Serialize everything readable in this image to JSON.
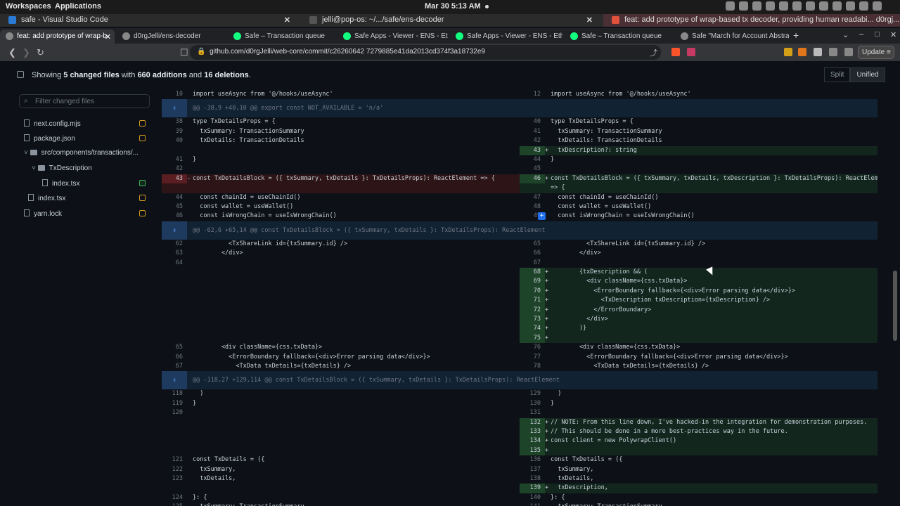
{
  "topbar": {
    "workspaces": "Workspaces",
    "applications": "Applications",
    "clock": "Mar 30  5:13 AM"
  },
  "window_tabs": [
    {
      "title": "safe - Visual Studio Code",
      "color": "#2b7bd6"
    },
    {
      "title": "jelli@pop-os: ~/.../safe/ens-decoder",
      "color": "#555"
    },
    {
      "title": "feat: add prototype of wrap-based tx decoder, providing human readabi... d0rgj...",
      "color": "#e0533a"
    }
  ],
  "browser_tabs": [
    {
      "title": "feat: add prototype of wrap-b",
      "fav": "#888",
      "active": true
    },
    {
      "title": "d0rgJelli/ens-decoder",
      "fav": "#888"
    },
    {
      "title": "Safe – Transaction queue",
      "fav": "#12ff80"
    },
    {
      "title": "Safe Apps - Viewer - ENS - Ethereu",
      "fav": "#12ff80"
    },
    {
      "title": "Safe Apps - Viewer - ENS - Ethereu",
      "fav": "#12ff80"
    },
    {
      "title": "Safe – Transaction queue",
      "fav": "#12ff80"
    },
    {
      "title": "Safe \"March for Account Abstracti",
      "fav": "#888"
    }
  ],
  "address": {
    "url": "github.com/d0rgJelli/web-core/commit/c26260642 7279885e41da2013cd374f3a18732e9",
    "update": "Update"
  },
  "summary": {
    "prefix": "Showing ",
    "files": "5 changed files",
    "mid": " with ",
    "adds": "660 additions",
    "and": " and ",
    "dels": "16 deletions",
    "suffix": "."
  },
  "view": {
    "split": "Split",
    "unified": "Unified"
  },
  "filter_placeholder": "Filter changed files",
  "tree": [
    {
      "name": "next.config.mjs",
      "type": "file",
      "badge": "mod"
    },
    {
      "name": "package.json",
      "type": "file",
      "badge": "mod"
    },
    {
      "name": "src/components/transactions/...",
      "type": "dir"
    },
    {
      "name": "TxDescription",
      "type": "dir"
    },
    {
      "name": "index.tsx",
      "type": "file",
      "badge": "add"
    },
    {
      "name": "index.tsx",
      "type": "file",
      "badge": "mod"
    },
    {
      "name": "yarn.lock",
      "type": "file",
      "badge": "mod"
    }
  ],
  "diff_rows": [
    {
      "kind": "ctx",
      "l": [
        "10",
        "import useAsync from '@/hooks/useAsync'"
      ],
      "r": [
        "12",
        "import useAsync from '@/hooks/useAsync'"
      ]
    },
    {
      "kind": "hunk",
      "text": "@@ -38,9 +40,10 @@ export const NOT_AVAILABLE = 'n/a'"
    },
    {
      "kind": "ctx",
      "l": [
        "38",
        "type TxDetailsProps = {"
      ],
      "r": [
        "40",
        "type TxDetailsProps = {"
      ]
    },
    {
      "kind": "ctx",
      "l": [
        "39",
        "  txSummary: TransactionSummary"
      ],
      "r": [
        "41",
        "  txSummary: TransactionSummary"
      ]
    },
    {
      "kind": "ctx",
      "l": [
        "40",
        "  txDetails: TransactionDetails"
      ],
      "r": [
        "42",
        "  txDetails: TransactionDetails"
      ]
    },
    {
      "kind": "add",
      "l": null,
      "r": [
        "43",
        "  txDescription?: string"
      ]
    },
    {
      "kind": "ctx",
      "l": [
        "41",
        "}"
      ],
      "r": [
        "44",
        "}"
      ]
    },
    {
      "kind": "ctx",
      "l": [
        "42",
        ""
      ],
      "r": [
        "45",
        ""
      ]
    },
    {
      "kind": "chg2",
      "l": [
        "43",
        "const TxDetailsBlock = ({ txSummary, txDetails }: TxDetailsProps): ReactElement => {"
      ],
      "r": [
        "46",
        "const TxDetailsBlock = ({ txSummary, txDetails, txDescription }: TxDetailsProps): ReactElement"
      ],
      "r2": "=> {"
    },
    {
      "kind": "ctx",
      "l": [
        "44",
        "  const chainId = useChainId()"
      ],
      "r": [
        "47",
        "  const chainId = useChainId()"
      ]
    },
    {
      "kind": "ctx",
      "l": [
        "45",
        "  const wallet = useWallet()"
      ],
      "r": [
        "48",
        "  const wallet = useWallet()"
      ]
    },
    {
      "kind": "ctxp",
      "l": [
        "46",
        "  const isWrongChain = useIsWrongChain()"
      ],
      "r": [
        "49",
        "  const isWrongChain = useIsWrongChain()"
      ]
    },
    {
      "kind": "hunk",
      "text": "@@ -62,6 +65,14 @@ const TxDetailsBlock = ({ txSummary, txDetails }: TxDetailsProps): ReactElement"
    },
    {
      "kind": "ctx",
      "l": [
        "62",
        "          <TxShareLink id={txSummary.id} />"
      ],
      "r": [
        "65",
        "          <TxShareLink id={txSummary.id} />"
      ]
    },
    {
      "kind": "ctx",
      "l": [
        "63",
        "        </div>"
      ],
      "r": [
        "66",
        "        </div>"
      ]
    },
    {
      "kind": "ctx",
      "l": [
        "64",
        ""
      ],
      "r": [
        "67",
        ""
      ]
    },
    {
      "kind": "add",
      "l": null,
      "r": [
        "68",
        "        {txDescription && ("
      ]
    },
    {
      "kind": "add",
      "l": null,
      "r": [
        "69",
        "          <div className={css.txData}>"
      ]
    },
    {
      "kind": "add",
      "l": null,
      "r": [
        "70",
        "            <ErrorBoundary fallback={<div>Error parsing data</div>}>"
      ]
    },
    {
      "kind": "add",
      "l": null,
      "r": [
        "71",
        "              <TxDescription txDescription={txDescription} />"
      ]
    },
    {
      "kind": "add",
      "l": null,
      "r": [
        "72",
        "            </ErrorBoundary>"
      ]
    },
    {
      "kind": "add",
      "l": null,
      "r": [
        "73",
        "          </div>"
      ]
    },
    {
      "kind": "add",
      "l": null,
      "r": [
        "74",
        "        )}"
      ]
    },
    {
      "kind": "add",
      "l": null,
      "r": [
        "75",
        ""
      ]
    },
    {
      "kind": "ctx",
      "l": [
        "65",
        "        <div className={css.txData}>"
      ],
      "r": [
        "76",
        "        <div className={css.txData}>"
      ]
    },
    {
      "kind": "ctx",
      "l": [
        "66",
        "          <ErrorBoundary fallback={<div>Error parsing data</div>}>"
      ],
      "r": [
        "77",
        "          <ErrorBoundary fallback={<div>Error parsing data</div>}>"
      ]
    },
    {
      "kind": "ctx",
      "l": [
        "67",
        "            <TxData txDetails={txDetails} />"
      ],
      "r": [
        "78",
        "            <TxData txDetails={txDetails} />"
      ]
    },
    {
      "kind": "hunk",
      "text": "@@ -118,27 +129,114 @@ const TxDetailsBlock = ({ txSummary, txDetails }: TxDetailsProps): ReactElement"
    },
    {
      "kind": "ctx",
      "l": [
        "118",
        "  )"
      ],
      "r": [
        "129",
        "  )"
      ]
    },
    {
      "kind": "ctx",
      "l": [
        "119",
        "}"
      ],
      "r": [
        "130",
        "}"
      ]
    },
    {
      "kind": "ctx",
      "l": [
        "120",
        ""
      ],
      "r": [
        "131",
        ""
      ]
    },
    {
      "kind": "add",
      "l": null,
      "r": [
        "132",
        "// NOTE: From this line down, I've hacked-in the integration for demonstration purposes."
      ]
    },
    {
      "kind": "add",
      "l": null,
      "r": [
        "133",
        "// This should be done in a more best-practices way in the future."
      ]
    },
    {
      "kind": "add",
      "l": null,
      "r": [
        "134",
        "const client = new PolywrapClient()"
      ]
    },
    {
      "kind": "add",
      "l": null,
      "r": [
        "135",
        ""
      ]
    },
    {
      "kind": "ctx",
      "l": [
        "121",
        "const TxDetails = ({"
      ],
      "r": [
        "136",
        "const TxDetails = ({"
      ]
    },
    {
      "kind": "ctx",
      "l": [
        "122",
        "  txSummary,"
      ],
      "r": [
        "137",
        "  txSummary,"
      ]
    },
    {
      "kind": "ctx",
      "l": [
        "123",
        "  txDetails,"
      ],
      "r": [
        "138",
        "  txDetails,"
      ]
    },
    {
      "kind": "add",
      "l": null,
      "r": [
        "139",
        "  txDescription,"
      ]
    },
    {
      "kind": "ctx",
      "l": [
        "124",
        "}: {"
      ],
      "r": [
        "140",
        "}: {"
      ]
    },
    {
      "kind": "ctx",
      "l": [
        "125",
        "  txSummary: TransactionSummary"
      ],
      "r": [
        "141",
        "  txSummary: TransactionSummary"
      ]
    }
  ]
}
